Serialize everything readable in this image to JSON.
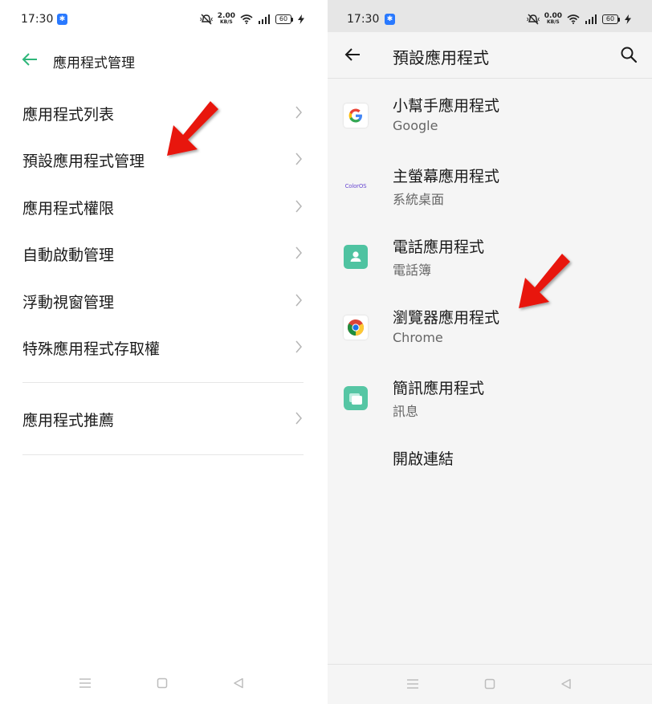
{
  "left": {
    "status": {
      "time": "17:30",
      "speed_value": "2.00",
      "speed_unit": "KB/S",
      "battery": "60"
    },
    "header": {
      "title": "應用程式管理"
    },
    "menu": [
      {
        "label": "應用程式列表"
      },
      {
        "label": "預設應用程式管理"
      },
      {
        "label": "應用程式權限"
      },
      {
        "label": "自動啟動管理"
      },
      {
        "label": "浮動視窗管理"
      },
      {
        "label": "特殊應用程式存取權"
      }
    ],
    "menu2": [
      {
        "label": "應用程式推薦"
      }
    ]
  },
  "right": {
    "status": {
      "time": "17:30",
      "speed_value": "0.00",
      "speed_unit": "KB/S",
      "battery": "60"
    },
    "header": {
      "title": "預設應用程式"
    },
    "apps": [
      {
        "label": "小幫手應用程式",
        "value": "Google",
        "icon": "google-icon"
      },
      {
        "label": "主螢幕應用程式",
        "value": "系統桌面",
        "icon": "coloros-icon",
        "icon_text": "ColorOS"
      },
      {
        "label": "電話應用程式",
        "value": "電話簿",
        "icon": "contacts-icon"
      },
      {
        "label": "瀏覽器應用程式",
        "value": "Chrome",
        "icon": "chrome-icon"
      },
      {
        "label": "簡訊應用程式",
        "value": "訊息",
        "icon": "messages-icon"
      },
      {
        "label": "開啟連結",
        "value": ""
      }
    ]
  },
  "colors": {
    "accent_green": "#2fb67a",
    "annotation_red": "#e8120c",
    "contacts_green": "#4fc3a1",
    "messages_green": "#56c6a4"
  }
}
